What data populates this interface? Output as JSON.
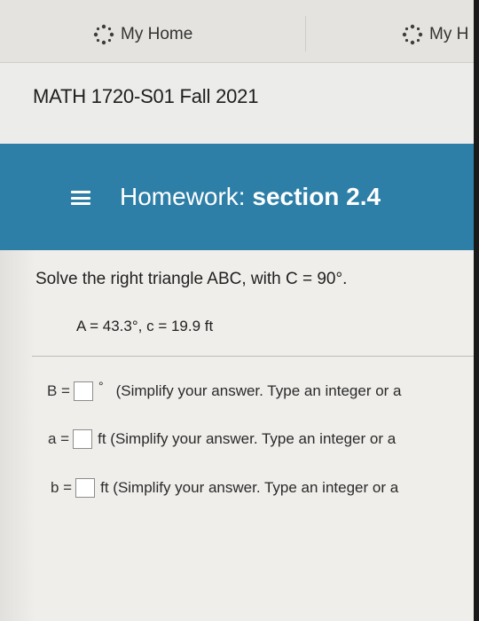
{
  "tabs": [
    {
      "label": "My Home",
      "icon": "sparkle-logo-icon"
    },
    {
      "label": "My H",
      "icon": "sparkle-logo-icon"
    }
  ],
  "course": {
    "title": "MATH 1720-S01 Fall 2021"
  },
  "banner": {
    "prefix": "Homework:",
    "section": "section 2.4",
    "color": "#2d7fa7"
  },
  "question": {
    "prompt": "Solve the right triangle ABC, with C = 90°.",
    "given": "A = 43.3°, c = 19.9 ft"
  },
  "answers": [
    {
      "variable": "B =",
      "unit": "°",
      "hint": "(Simplify your answer. Type an integer or a",
      "value": ""
    },
    {
      "variable": "a =",
      "unit": "",
      "hint": "ft (Simplify your answer. Type an integer or a",
      "value": ""
    },
    {
      "variable": "b =",
      "unit": "",
      "hint": "ft (Simplify your answer. Type an integer or a",
      "value": ""
    }
  ]
}
